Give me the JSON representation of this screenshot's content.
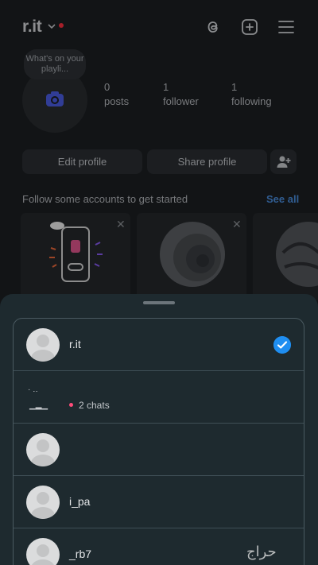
{
  "header": {
    "username": "r.it",
    "icons": [
      "threads-icon",
      "add-post-icon",
      "menu-icon"
    ]
  },
  "profile": {
    "note_text": "What's on your playli...",
    "stats": [
      {
        "count": "0",
        "label": "posts"
      },
      {
        "count": "1",
        "label": "follower"
      },
      {
        "count": "1",
        "label": "following"
      }
    ],
    "buttons": {
      "edit": "Edit profile",
      "share": "Share profile"
    }
  },
  "suggestions": {
    "title": "Follow some accounts to get started",
    "see_all": "See all"
  },
  "account_sheet": {
    "accounts": [
      {
        "name": "r.it",
        "selected": true
      },
      {
        "name": "",
        "chats": "2 chats",
        "selected": false
      },
      {
        "name": "",
        "selected": false
      },
      {
        "name": "i_pa",
        "selected": false
      },
      {
        "name": "_rb7",
        "selected": false
      }
    ]
  },
  "watermark": "حراج",
  "colors": {
    "accent": "#1f8ef1",
    "link": "#4b8fe0",
    "notification": "#ff3040",
    "chat_dot": "#ff4c7a"
  }
}
